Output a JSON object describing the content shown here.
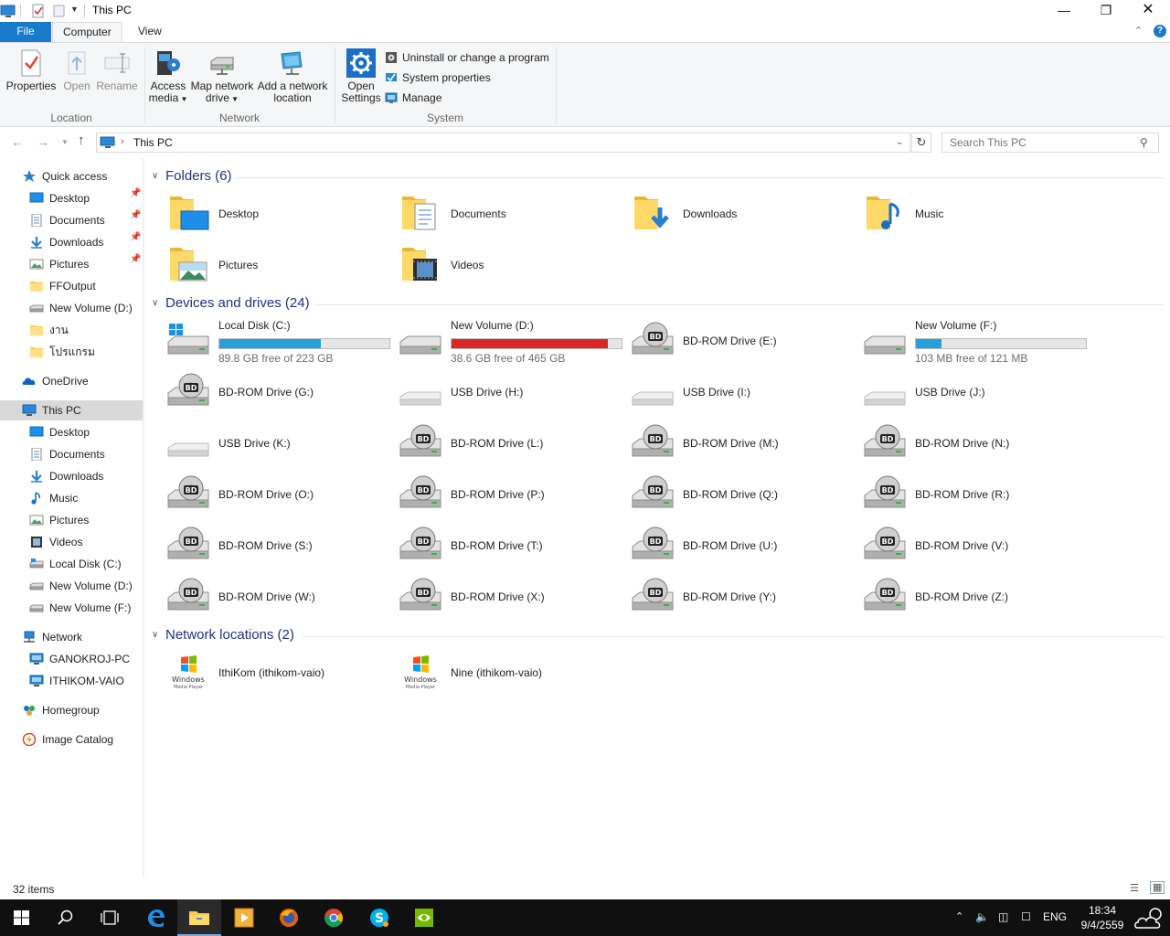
{
  "window": {
    "title": "This PC"
  },
  "ribbon": {
    "tabs": [
      "File",
      "Computer",
      "View"
    ],
    "location": {
      "properties": "Properties",
      "open": "Open",
      "rename": "Rename",
      "group": "Location"
    },
    "network": {
      "access_media_1": "Access",
      "access_media_2": "media",
      "map_drive_1": "Map network",
      "map_drive_2": "drive",
      "add_location_1": "Add a network",
      "add_location_2": "location",
      "group": "Network"
    },
    "system": {
      "open_settings_1": "Open",
      "open_settings_2": "Settings",
      "uninstall": "Uninstall or change a program",
      "system_properties": "System properties",
      "manage": "Manage",
      "group": "System"
    }
  },
  "address": {
    "path": "This PC",
    "search_placeholder": "Search This PC"
  },
  "nav": {
    "quick_access": "Quick access",
    "qa_items": [
      "Desktop",
      "Documents",
      "Downloads",
      "Pictures",
      "FFOutput",
      "New Volume (D:)",
      "งาน",
      "โปรแกรม"
    ],
    "onedrive": "OneDrive",
    "this_pc": "This PC",
    "pc_items": [
      "Desktop",
      "Documents",
      "Downloads",
      "Music",
      "Pictures",
      "Videos",
      "Local Disk (C:)",
      "New Volume (D:)",
      "New Volume (F:)"
    ],
    "network": "Network",
    "net_items": [
      "GANOKROJ-PC",
      "ITHIKOM-VAIO"
    ],
    "homegroup": "Homegroup",
    "image_catalog": "Image Catalog"
  },
  "sections": {
    "folders": "Folders (6)",
    "devices": "Devices and drives (24)",
    "network": "Network locations (2)"
  },
  "folders": [
    "Desktop",
    "Documents",
    "Downloads",
    "Music",
    "Pictures",
    "Videos"
  ],
  "drives": [
    {
      "name": "Local Disk (C:)",
      "free": "89.8 GB free of 223 GB",
      "used_fraction": 0.597
    },
    {
      "name": "New Volume (D:)",
      "free": "38.6 GB free of 465 GB",
      "used_fraction": 0.917
    },
    {
      "name": "BD-ROM Drive (E:)"
    },
    {
      "name": "New Volume (F:)",
      "free": "103 MB free of 121 MB",
      "used_fraction": 0.149
    },
    {
      "name": "BD-ROM Drive (G:)"
    },
    {
      "name": "USB Drive (H:)"
    },
    {
      "name": "USB Drive (I:)"
    },
    {
      "name": "USB Drive (J:)"
    },
    {
      "name": "USB Drive (K:)"
    },
    {
      "name": "BD-ROM Drive (L:)"
    },
    {
      "name": "BD-ROM Drive (M:)"
    },
    {
      "name": "BD-ROM Drive (N:)"
    },
    {
      "name": "BD-ROM Drive (O:)"
    },
    {
      "name": "BD-ROM Drive (P:)"
    },
    {
      "name": "BD-ROM Drive (Q:)"
    },
    {
      "name": "BD-ROM Drive (R:)"
    },
    {
      "name": "BD-ROM Drive (S:)"
    },
    {
      "name": "BD-ROM Drive (T:)"
    },
    {
      "name": "BD-ROM Drive (U:)"
    },
    {
      "name": "BD-ROM Drive (V:)"
    },
    {
      "name": "BD-ROM Drive (W:)"
    },
    {
      "name": "BD-ROM Drive (X:)"
    },
    {
      "name": "BD-ROM Drive (Y:)"
    },
    {
      "name": "BD-ROM Drive (Z:)"
    }
  ],
  "network_locations": [
    "IthiKom (ithikom-vaio)",
    "Nine (ithikom-vaio)"
  ],
  "status": {
    "count": "32 items"
  },
  "taskbar": {
    "lang": "ENG",
    "time": "18:34",
    "date": "9/4/2559"
  },
  "colors": {
    "accent": "#1979ca",
    "bar_normal": "#26a0da",
    "bar_full": "#da2626",
    "section_title": "#1e3287"
  }
}
